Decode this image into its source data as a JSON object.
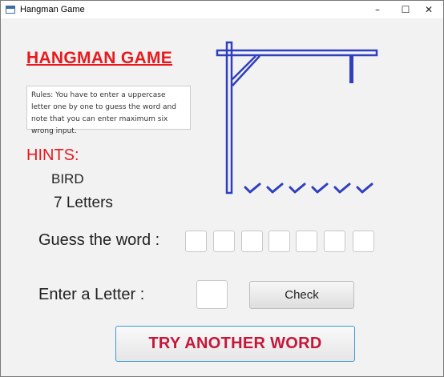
{
  "window": {
    "title": "Hangman Game",
    "minimize_glyph": "–",
    "maximize_glyph": "☐",
    "close_glyph": "✕"
  },
  "game": {
    "heading": "HANGMAN GAME",
    "rules": "Rules: You have to enter a uppercase letter one by one to guess the word and note that you can enter maximum six wrong input.",
    "hints_title": "HINTS:",
    "hint_word": "BIRD",
    "hint_letters": "7 Letters",
    "guess_label": "Guess the word :",
    "word_slots": [
      "",
      "",
      "",
      "",
      "",
      "",
      ""
    ],
    "remaining_attempts": 6,
    "letter_label": "Enter a Letter :",
    "letter_value": "",
    "check_label": "Check",
    "try_another_label": "TRY ANOTHER WORD"
  },
  "colors": {
    "heading": "#e8191c",
    "gallows": "#2f3fbf",
    "try_button_text": "#c4183a"
  }
}
